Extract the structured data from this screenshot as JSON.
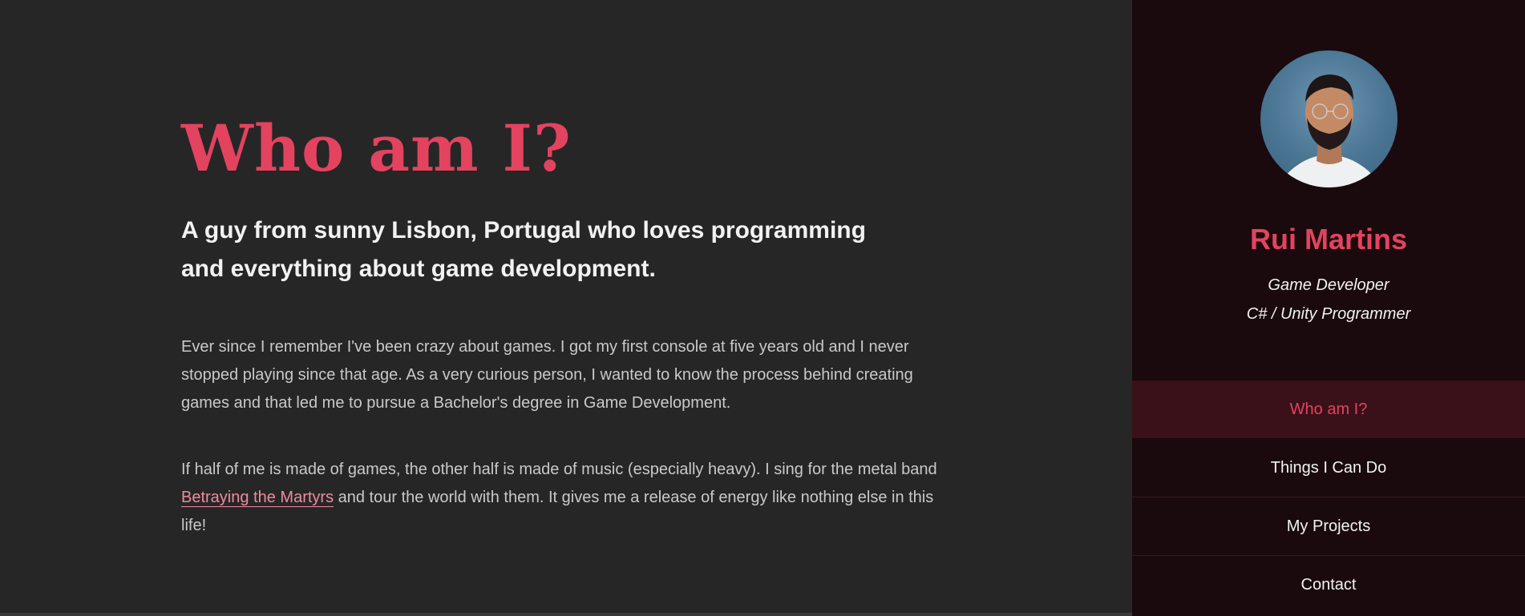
{
  "main": {
    "title": "Who am I?",
    "subtitle": "A guy from sunny Lisbon, Portugal who loves programming and everything about game development.",
    "paragraph1": "Ever since I remember I've been crazy about games. I got my first console at five years old and I never stopped playing since that age. As a very curious person, I wanted to know the process behind creating games and that led me to pursue a Bachelor's degree in Game Development.",
    "paragraph2_before": "If half of me is made of games, the other half is made of music (especially heavy). I sing for the metal band ",
    "paragraph2_link": "Betraying the Martyrs",
    "paragraph2_after": " and tour the world with them. It gives me a release of energy like nothing else in this life!"
  },
  "sidebar": {
    "name": "Rui Martins",
    "role1": "Game Developer",
    "role2": "C# / Unity Programmer",
    "nav": [
      {
        "label": "Who am I?",
        "active": true
      },
      {
        "label": "Things I Can Do",
        "active": false
      },
      {
        "label": "My Projects",
        "active": false
      },
      {
        "label": "Contact",
        "active": false
      }
    ]
  },
  "colors": {
    "accent": "#e3435f",
    "main_bg": "#262626",
    "sidebar_bg": "#1a0a0d",
    "active_nav_bg": "#3a1019"
  }
}
